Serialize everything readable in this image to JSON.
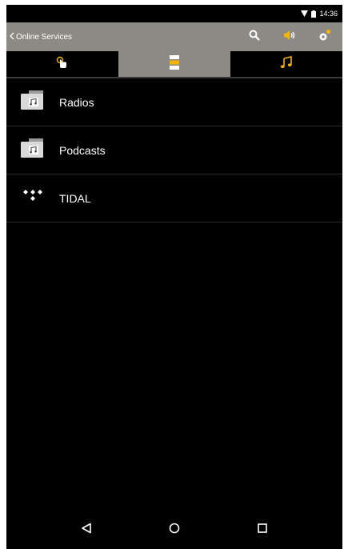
{
  "status_bar": {
    "time": "14:36",
    "icons": [
      "wifi-icon",
      "battery-icon"
    ]
  },
  "app_bar": {
    "back_icon": "chevron-left-icon",
    "title": "Online Services",
    "actions": [
      "search-icon",
      "volume-icon",
      "settings-icon"
    ]
  },
  "tabs": [
    {
      "icon": "touch-icon",
      "active": false
    },
    {
      "icon": "sources-icon",
      "active": true
    },
    {
      "icon": "music-note-icon",
      "active": false
    }
  ],
  "list": {
    "items": [
      {
        "label": "Radios",
        "icon": "radio-folder-icon"
      },
      {
        "label": "Podcasts",
        "icon": "podcast-folder-icon"
      },
      {
        "label": "TIDAL",
        "icon": "tidal-logo-icon"
      }
    ]
  },
  "nav_bar": {
    "buttons": [
      "back-triangle-icon",
      "home-circle-icon",
      "recents-square-icon"
    ]
  },
  "colors": {
    "app_bar": "#8c8a84",
    "accent_yellow": "#f4b400",
    "background": "#000000",
    "text": "#ffffff"
  }
}
